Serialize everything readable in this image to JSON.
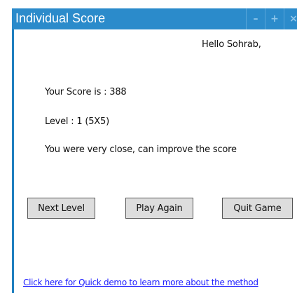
{
  "window": {
    "title": "Individual Score",
    "controls": {
      "minimize": "–",
      "maximize": "+",
      "close": "×"
    }
  },
  "greeting": "Hello Sohrab,",
  "score_line": "Your Score is : 388",
  "level_line": "Level : 1 (5X5)",
  "message": "You were very close, can improve the score",
  "buttons": {
    "next_level": "Next Level",
    "play_again": "Play Again",
    "quit_game": "Quit Game"
  },
  "demo_link": "Click here for Quick demo to learn more about the method",
  "colors": {
    "titlebar": "#2b8bcb",
    "link": "#1a1aff",
    "button_bg": "#dddddd"
  }
}
